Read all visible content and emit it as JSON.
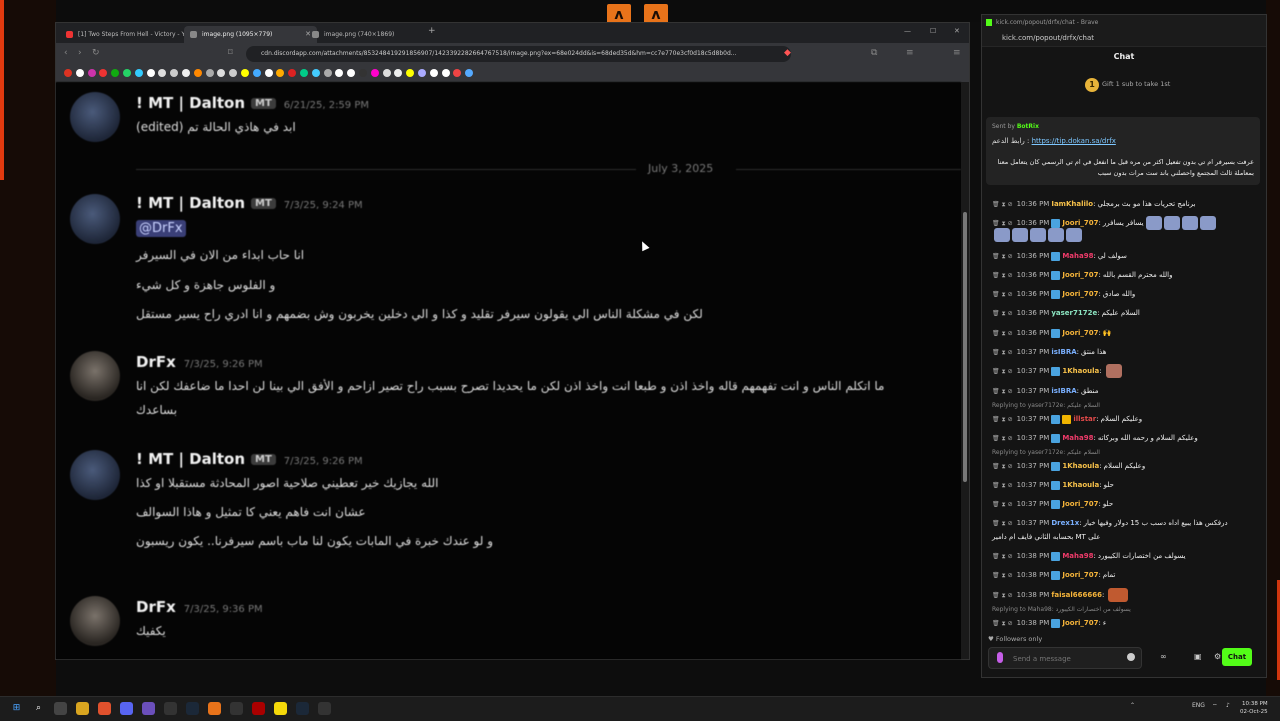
{
  "browser": {
    "tabs": [
      {
        "title": "[1] Two Steps From Hell - Victory - Y",
        "fav": "#e33"
      },
      {
        "title": "image.png (1095×779)",
        "fav": "#5865f2"
      },
      {
        "title": "image.png (740×1869)",
        "fav": "#5865f2"
      }
    ],
    "url": "cdn.discordapp.com/attachments/853248419291856907/1423392282664767518/image.png?ex=68e024dd&is=68ded35d&hm=cc7e770e3cf0d18c5d8b0d...",
    "bookmark_colors": [
      "#d32",
      "#fff",
      "#c3a",
      "#e33",
      "#1a1",
      "#25d366",
      "#3cf",
      "#fff",
      "#ddd",
      "#ccc",
      "#eee",
      "#f80",
      "#aaa",
      "#ddd",
      "#ccc",
      "#ff0",
      "#4af",
      "#fff",
      "#fa0",
      "#d22",
      "#0c8",
      "#4cf",
      "#aaa",
      "#fff",
      "#fff",
      "#333",
      "#f0c",
      "#ddd",
      "#eee",
      "#ff0",
      "#aaf",
      "#fff",
      "#fff",
      "#e44",
      "#5af"
    ]
  },
  "discord": {
    "date_separator": "July 3, 2025",
    "messages": [
      {
        "user": "! MT | Dalton",
        "tag": "MT",
        "time": "6/21/25, 2:59 PM",
        "lines": [
          "ابد في هاذي الحالة تم (edited)"
        ]
      },
      {
        "user": "! MT | Dalton",
        "tag": "MT",
        "time": "7/3/25, 9:24 PM",
        "mention": "@DrFx",
        "lines": [
          "انا حاب ابداء من الان في السيرفر",
          "و الفلوس جاهزة و كل شيء",
          "لكن في مشكلة الناس الي يقولون سيرفر تقليد و كذا و الي دخلين يخربون وش بضمهم و انا ادري راح يسير مستقل"
        ]
      },
      {
        "user": "DrFx",
        "tag": "",
        "time": "7/3/25, 9:26 PM",
        "lines": [
          "ما اتكلم الناس و انت تفهمهم قاله واخذ اذن و طبعا انت واخذ اذن لكن ما يحديدا تصرح بسبب راح تصير ازاحم و الأفق الي بينا لن احدا ما ضاعفك لكن انا",
          "بساعدك"
        ]
      },
      {
        "user": "! MT | Dalton",
        "tag": "MT",
        "time": "7/3/25, 9:26 PM",
        "lines": [
          "الله يجازيك خير تعطيني صلاحية اصور المحادثة مستقبلا او كذا",
          "عشان انت فاهم يعني كا تمثيل و هاذا السوالف",
          "و لو عندك خبرة في المابات يكون لنا ماب باسم سيرفرنا.. يكون ريسبون"
        ]
      },
      {
        "user": "DrFx",
        "tag": "",
        "time": "7/3/25, 9:36 PM",
        "lines": [
          "يكفيك"
        ]
      }
    ]
  },
  "chat": {
    "window_title": "kick.com/popout/drfx/chat - Brave",
    "url": "kick.com/popout/drfx/chat",
    "heading": "Chat",
    "gift_text": "Gift 1 sub to take 1st",
    "gift_count": "1",
    "pinned": {
      "sent_by": "Sent by",
      "bot": "BotRix",
      "link_label": "رابط الدعم :",
      "link": "https://tip.dokan.sa/drfx",
      "body": "عرفت بسيرفر ام تي بدون تفعيل اكثر من مره قبل ما انفعل في ام تي الرسمي كان يتعامل معنا بمعاملة ثالث المجتمع واحصلني باند ست مرات بدون سبب"
    },
    "messages": [
      {
        "time": "10:36 PM",
        "user": "IamKhalilo",
        "color": "#f7c14a",
        "text": "برنامج تحريات هذا مو بث برمجلي",
        "badge": false
      },
      {
        "time": "10:36 PM",
        "user": "Joori_707",
        "color": "#f7b53a",
        "text": "يسافر يسافرر",
        "badge": true
      },
      {
        "time": "10:36 PM",
        "user": "Maha98",
        "color": "#ef3b6a",
        "text": "سولف لي",
        "badge": true
      },
      {
        "time": "10:36 PM",
        "user": "Joori_707",
        "color": "#f7b53a",
        "text": "والله محترم القسم بالله",
        "badge": true
      },
      {
        "time": "10:36 PM",
        "user": "Joori_707",
        "color": "#f7b53a",
        "text": "والله صادق",
        "badge": true
      },
      {
        "time": "10:36 PM",
        "user": "yaser7172e",
        "color": "#8be3c0",
        "text": "السلام عليكم",
        "badge": false
      },
      {
        "time": "10:36 PM",
        "user": "Joori_707",
        "color": "#f7b53a",
        "text": "🙌",
        "badge": true
      },
      {
        "time": "10:37 PM",
        "user": "isIBRA",
        "color": "#7ab0ff",
        "text": "هذا منتق",
        "badge": false
      },
      {
        "time": "10:37 PM",
        "user": "1Khaoula",
        "color": "#f7c14a",
        "text": "",
        "badge": true
      },
      {
        "time": "10:37 PM",
        "user": "isIBRA",
        "color": "#7ab0ff",
        "text": "منطق",
        "badge": false
      },
      {
        "time": "10:37 PM",
        "user": "illstar",
        "color": "#e34a4a",
        "text": "وعليكم السلام",
        "badge": true,
        "reply": "Replying to yaser7172e: السلام عليكم"
      },
      {
        "time": "10:37 PM",
        "user": "Maha98",
        "color": "#ef3b6a",
        "text": "وعليكم السلام و رحمه الله وبركاته",
        "badge": true
      },
      {
        "time": "10:37 PM",
        "user": "1Khaoula",
        "color": "#f7c14a",
        "text": "وعليكم السلام",
        "badge": true,
        "reply": "Replying to yaser7172e: السلام عليكم"
      },
      {
        "time": "10:37 PM",
        "user": "1Khaoula",
        "color": "#f7c14a",
        "text": "حلو",
        "badge": true
      },
      {
        "time": "10:37 PM",
        "user": "Joori_707",
        "color": "#f7b53a",
        "text": "حلو",
        "badge": true
      },
      {
        "time": "10:37 PM",
        "user": "Drex1x",
        "color": "#7ab0ff",
        "text": "درفكس هذا يبيع اداه دسب ب 15 دولار وفيها خيار",
        "badge": false,
        "cont": "بحسابه الثاني فايف ام دامير MT على"
      },
      {
        "time": "10:38 PM",
        "user": "Maha98",
        "color": "#ef3b6a",
        "text": "يسولف من اختصارات الكيبورد",
        "badge": true
      },
      {
        "time": "10:38 PM",
        "user": "Joori_707",
        "color": "#f7b53a",
        "text": "تمام",
        "badge": true
      },
      {
        "time": "10:38 PM",
        "user": "faisal666666",
        "color": "#f7b53a",
        "text": "",
        "badge": false
      },
      {
        "time": "10:38 PM",
        "user": "Joori_707",
        "color": "#f7b53a",
        "text": "ء",
        "badge": true,
        "reply": "Replying to Maha98: يسولف من اختصارات الكيبورد"
      }
    ],
    "followers_only": "Followers only",
    "send_placeholder": "Send a message",
    "chat_button": "Chat",
    "accent": "#53fc18"
  },
  "taskbar": {
    "time": "10:38 PM",
    "date": "02-Oct-25",
    "lang": "ENG"
  }
}
